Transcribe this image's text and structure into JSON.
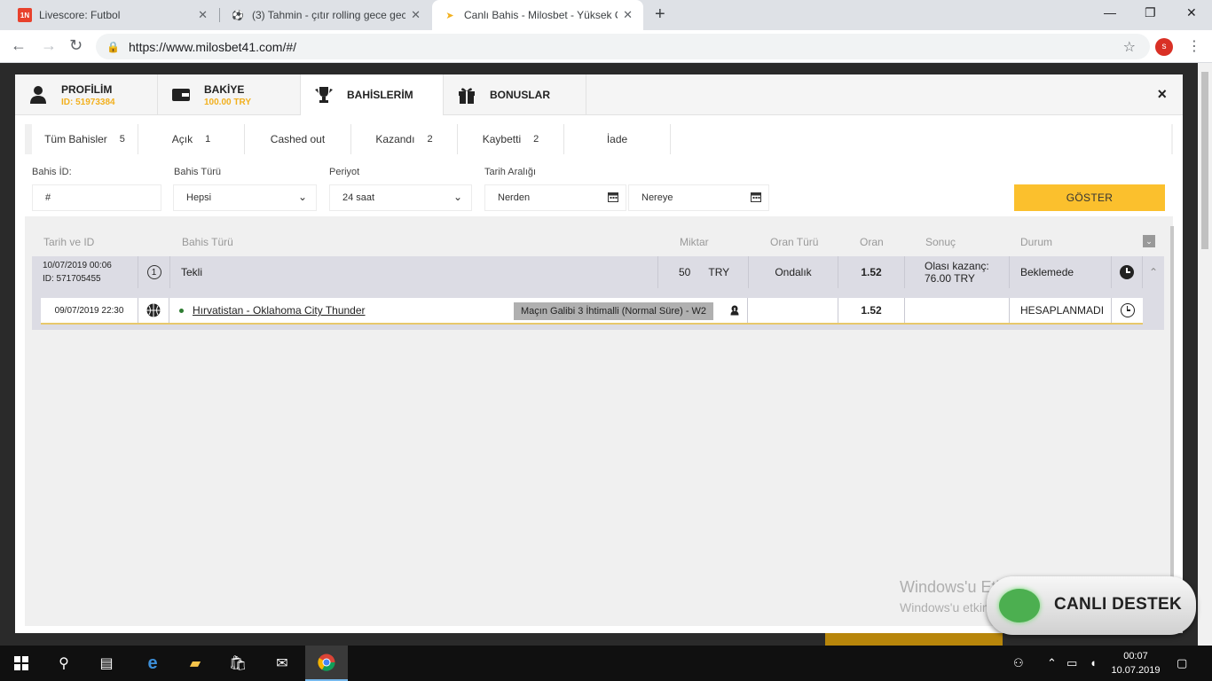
{
  "browser": {
    "tabs": [
      {
        "title": "Livescore: Futbol",
        "icon": "1n-icon",
        "active": false
      },
      {
        "title": "(3) Tahmin - çıtır rolling gece gec",
        "icon": "soccer-ball-icon",
        "active": false
      },
      {
        "title": "Canlı Bahis - Milosbet - Yüksek O",
        "icon": "milosbet-icon",
        "active": true
      }
    ],
    "url": "https://www.milosbet41.com/#/",
    "profile_initial": "s"
  },
  "modal": {
    "tabs": [
      {
        "label": "PROFİLİM",
        "sub": "ID: 51973384",
        "icon": "user-icon"
      },
      {
        "label": "BAKİYE",
        "sub": "100.00 TRY",
        "icon": "wallet-icon"
      },
      {
        "label": "BAHİSLERİM",
        "sub": "",
        "icon": "trophy-icon"
      },
      {
        "label": "BONUSLAR",
        "sub": "",
        "icon": "gift-icon"
      }
    ],
    "active_tab": "BAHİSLERİM",
    "close": "×"
  },
  "filter_tabs": [
    {
      "label": "Tüm Bahisler",
      "count": "5"
    },
    {
      "label": "Açık",
      "count": "1"
    },
    {
      "label": "Cashed out",
      "count": ""
    },
    {
      "label": "Kazandı",
      "count": "2"
    },
    {
      "label": "Kaybetti",
      "count": "2"
    },
    {
      "label": "İade",
      "count": ""
    }
  ],
  "filters": {
    "bet_id_label": "Bahis İD:",
    "bet_id_value": "#",
    "bet_type_label": "Bahis Türü",
    "bet_type_value": "Hepsi",
    "period_label": "Periyot",
    "period_value": "24 saat",
    "date_range_label": "Tarih Aralığı",
    "from_value": "Nerden",
    "to_value": "Nereye",
    "show_button": "GÖSTER"
  },
  "table": {
    "headers": {
      "date_id": "Tarih ve ID",
      "type": "Bahis Türü",
      "amount": "Miktar",
      "odds_type": "Oran Türü",
      "odds": "Oran",
      "result": "Sonuç",
      "status": "Durum"
    },
    "bet": {
      "date": "10/07/2019 00:06",
      "id": "ID: 571705455",
      "kind_icon_text": "1",
      "type": "Tekli",
      "amount": "50",
      "currency": "TRY",
      "odds_type": "Ondalık",
      "odds": "1.52",
      "result_line1": "Olası kazanç:",
      "result_line2": "76.00 TRY",
      "status": "Beklemede",
      "event": {
        "date": "09/07/2019 22:30",
        "name": "Hırvatistan - Oklahoma City Thunder",
        "market": "Maçın Galibi 3 İhtimalli (Normal Süre) - W2",
        "odds": "1.52",
        "status": "HESAPLANMADI"
      }
    }
  },
  "overlay": {
    "watermark_line1": "Windows'u Etkinleştir",
    "watermark_line2": "Windows'u etkinleştirmek için Ayarlar'a gidin.",
    "chat_label": "CANLI DESTEK"
  },
  "taskbar": {
    "time": "00:07",
    "date": "10.07.2019"
  },
  "colors": {
    "accent": "#fbc02d",
    "balance": "#f2b01e",
    "row_bg": "#dcdce4"
  }
}
